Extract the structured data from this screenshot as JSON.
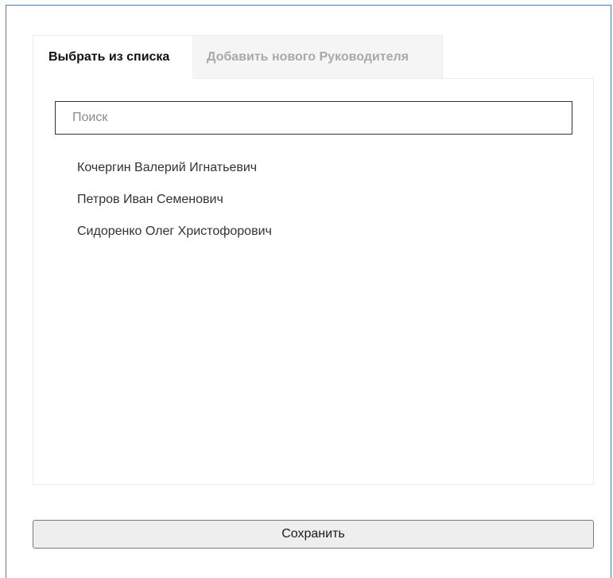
{
  "tabs": [
    {
      "label": "Выбрать из списка",
      "active": true
    },
    {
      "label": "Добавить нового Руководителя",
      "active": false
    }
  ],
  "search": {
    "placeholder": "Поиск",
    "value": ""
  },
  "list": {
    "items": [
      "Кочергин Валерий Игнатьевич",
      "Петров Иван Семенович",
      "Сидоренко Олег Христофорович"
    ]
  },
  "footer": {
    "save_label": "Сохранить"
  },
  "colors": {
    "frame_border": "#4a7ebb",
    "inactive_tab_text": "#a9a9a9",
    "button_bg": "#eeeeee"
  }
}
